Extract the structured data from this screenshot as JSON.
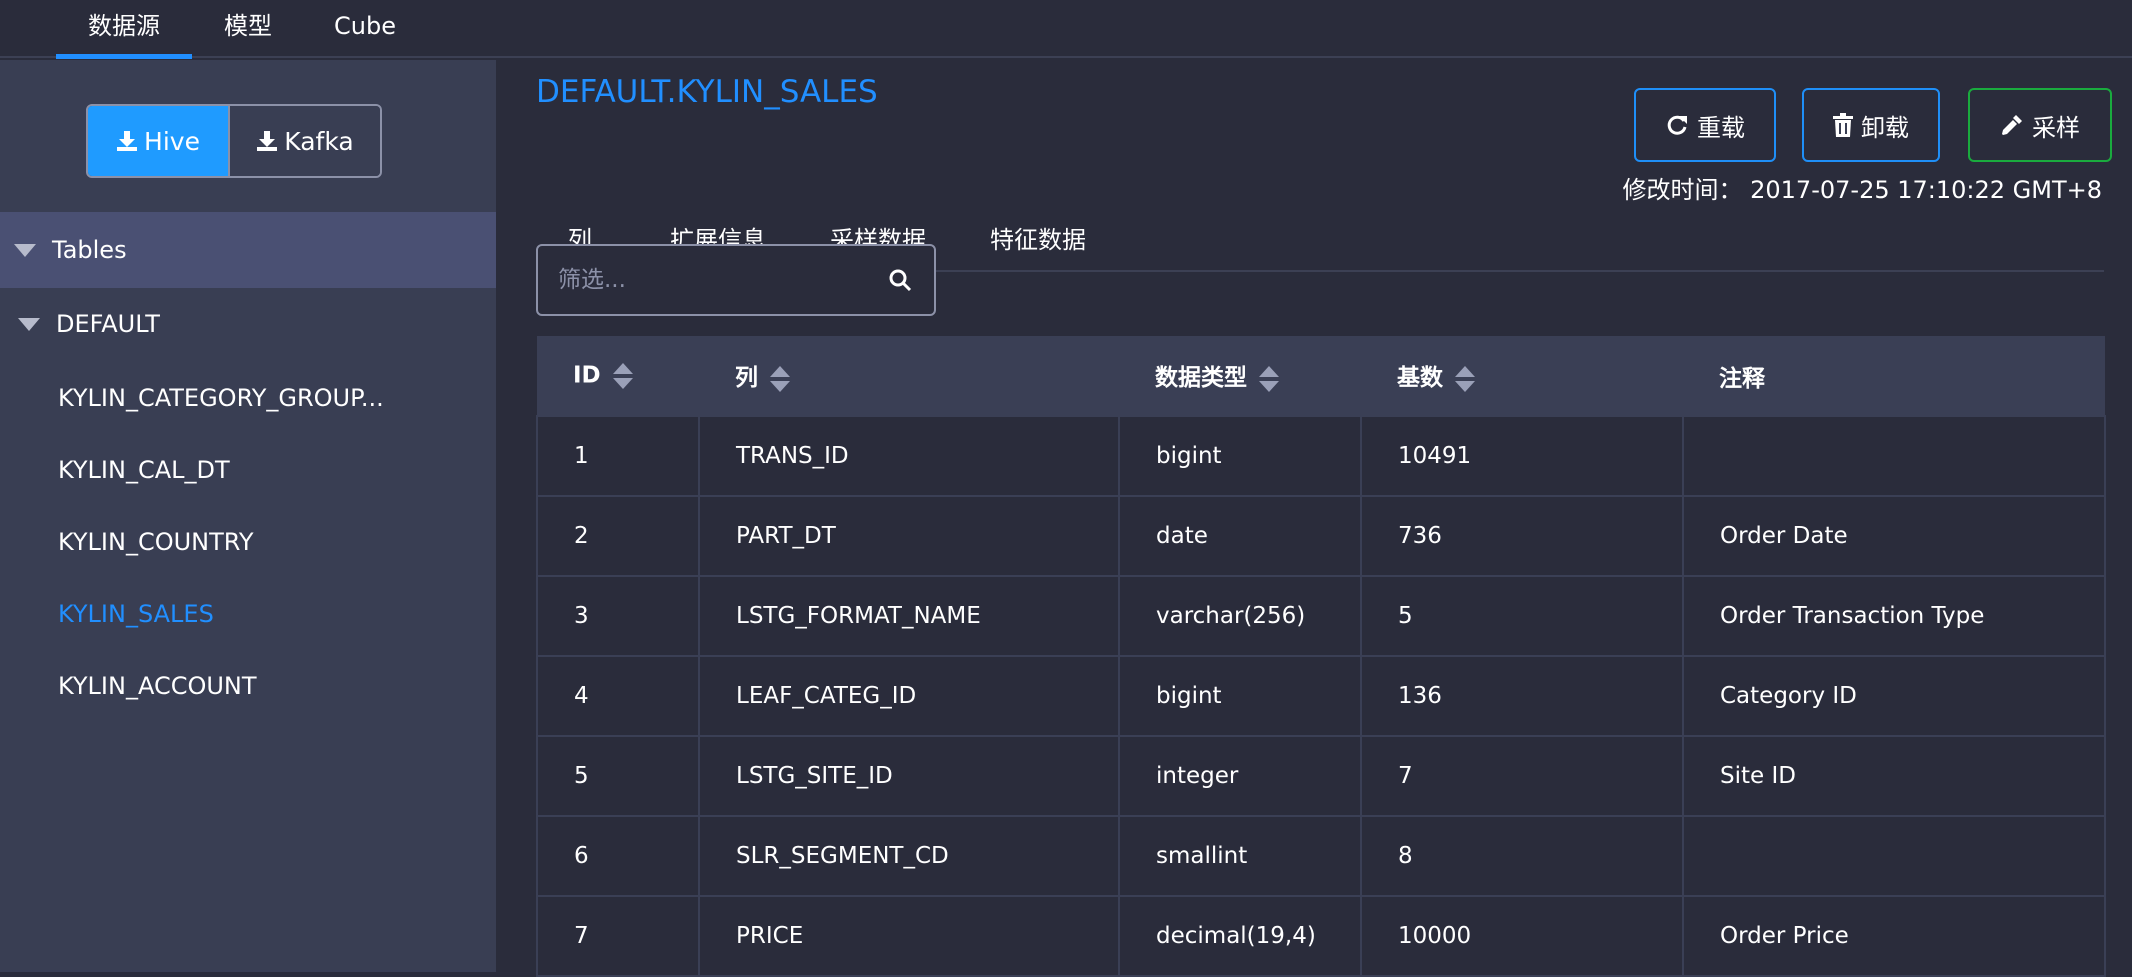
{
  "topnav": {
    "tabs": [
      {
        "label": "数据源"
      },
      {
        "label": "模型"
      },
      {
        "label": "Cube"
      }
    ]
  },
  "sidebar": {
    "source_buttons": {
      "hive": "Hive",
      "kafka": "Kafka"
    },
    "tree_header": "Tables",
    "database": "DEFAULT",
    "tables": [
      "KYLIN_CATEGORY_GROUP...",
      "KYLIN_CAL_DT",
      "KYLIN_COUNTRY",
      "KYLIN_SALES",
      "KYLIN_ACCOUNT"
    ]
  },
  "main": {
    "title": "DEFAULT.KYLIN_SALES",
    "tabs": [
      "列",
      "扩展信息",
      "采样数据",
      "特征数据"
    ],
    "actions": {
      "reload": "重载",
      "unload": "卸载",
      "sample": "采样"
    },
    "modified_label": "修改时间：",
    "modified_value": "2017-07-25 17:10:22 GMT+8",
    "filter_placeholder": "筛选...",
    "table": {
      "headers": [
        "ID",
        "列",
        "数据类型",
        "基数",
        "注释"
      ],
      "rows": [
        [
          "1",
          "TRANS_ID",
          "bigint",
          "10491",
          ""
        ],
        [
          "2",
          "PART_DT",
          "date",
          "736",
          "Order Date"
        ],
        [
          "3",
          "LSTG_FORMAT_NAME",
          "varchar(256)",
          "5",
          "Order Transaction Type"
        ],
        [
          "4",
          "LEAF_CATEG_ID",
          "bigint",
          "136",
          "Category ID"
        ],
        [
          "5",
          "LSTG_SITE_ID",
          "integer",
          "7",
          "Site ID"
        ],
        [
          "6",
          "SLR_SEGMENT_CD",
          "smallint",
          "8",
          ""
        ],
        [
          "7",
          "PRICE",
          "decimal(19,4)",
          "10000",
          "Order Price"
        ]
      ]
    }
  },
  "colors": {
    "accent": "#218fff",
    "background": "#2a2c3b",
    "sidebar": "#393e53",
    "sample_border": "#1aab3e"
  }
}
